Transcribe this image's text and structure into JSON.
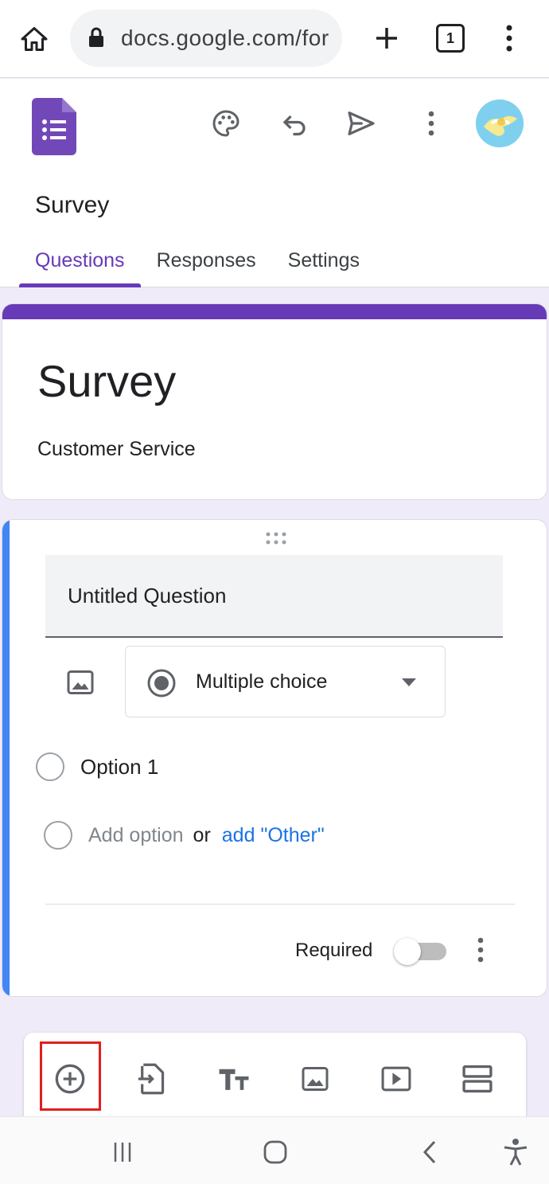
{
  "browser": {
    "url": "docs.google.com/for",
    "tab_count": "1"
  },
  "header": {
    "form_name": "Survey",
    "tabs": [
      {
        "label": "Questions",
        "active": true
      },
      {
        "label": "Responses",
        "active": false
      },
      {
        "label": "Settings",
        "active": false
      }
    ]
  },
  "title_card": {
    "title": "Survey",
    "description": "Customer Service"
  },
  "question": {
    "title": "Untitled Question",
    "type_label": "Multiple choice",
    "options": [
      "Option 1"
    ],
    "add_option_text": "Add option",
    "or_text": "or",
    "add_other_text": "add \"Other\"",
    "required_label": "Required",
    "required_on": false
  },
  "toolbar": {
    "items": [
      "add-question",
      "import-questions",
      "add-title-description",
      "add-image",
      "add-video",
      "add-section"
    ],
    "highlighted": "add-question"
  },
  "colors": {
    "accent": "#673ab7",
    "question_accent": "#4285f4",
    "link": "#1a73e8",
    "highlight": "#e0201c"
  }
}
